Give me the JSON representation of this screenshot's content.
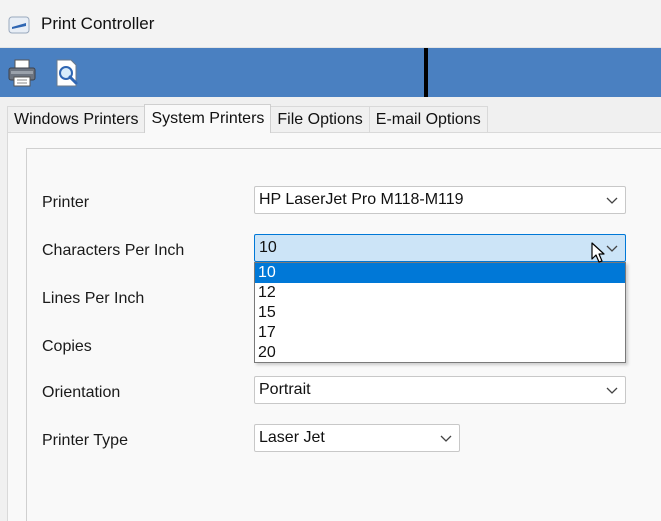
{
  "window": {
    "title": "Print Controller"
  },
  "toolbar": {
    "buttons": [
      {
        "icon": "printer-icon"
      },
      {
        "icon": "print-preview-icon"
      }
    ]
  },
  "tabs": [
    {
      "label": "Windows Printers",
      "active": false
    },
    {
      "label": "System Printers",
      "active": true
    },
    {
      "label": "File Options",
      "active": false
    },
    {
      "label": "E-mail Options",
      "active": false
    }
  ],
  "form": {
    "printer": {
      "label": "Printer",
      "value": "HP LaserJet Pro M118-M119"
    },
    "cpi": {
      "label": "Characters Per Inch",
      "value": "10"
    },
    "lpi": {
      "label": "Lines Per Inch"
    },
    "copies": {
      "label": "Copies"
    },
    "orientation": {
      "label": "Orientation",
      "value": "Portrait"
    },
    "printer_type": {
      "label": "Printer Type",
      "value": "Laser Jet"
    }
  },
  "dropdown": {
    "options": [
      "10",
      "12",
      "15",
      "17",
      "20"
    ],
    "selected": "10"
  },
  "colors": {
    "toolbar": "#4a80c1",
    "selection": "#0078d7",
    "focus_fill": "#cce4f7"
  }
}
